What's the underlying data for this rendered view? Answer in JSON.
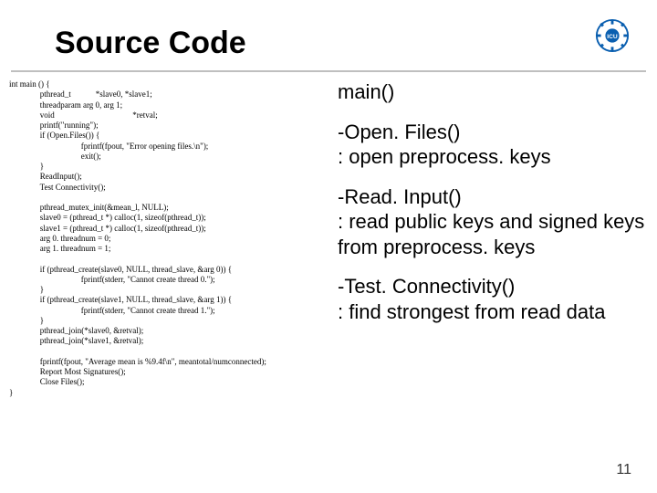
{
  "title": "Source Code",
  "page_number": "11",
  "code": "int main () {\n               pthread_t            *slave0, *slave1;\n               threadparam arg 0, arg 1;\n               void                                      *retval;\n               printf(\"running\");\n               if (Open.Files()) {\n                                   fprintf(fpout, \"Error opening files.\\n\");\n                                   exit();\n               }\n               ReadInput();\n               Test Connectivity();\n\n               pthread_mutex_init(&mean_l, NULL);\n               slave0 = (pthread_t *) calloc(1, sizeof(pthread_t));\n               slave1 = (pthread_t *) calloc(1, sizeof(pthread_t));\n               arg 0. threadnum = 0;\n               arg 1. threadnum = 1;\n\n               if (pthread_create(slave0, NULL, thread_slave, &arg 0)) {\n                                   fprintf(stderr, \"Cannot create thread 0.\");\n               }\n               if (pthread_create(slave1, NULL, thread_slave, &arg 1)) {\n                                   fprintf(stderr, \"Cannot create thread 1.\");\n               }\n               pthread_join(*slave0, &retval);\n               pthread_join(*slave1, &retval);\n\n               fprintf(fpout, \"Average mean is %9.4f\\n\", meantotal/numconnected);\n               Report Most Signatures();\n               Close Files();\n}",
  "explanations": [
    "main()",
    "-Open. Files()\n: open preprocess. keys",
    "-Read. Input()\n: read public keys and signed keys from preprocess. keys",
    "-Test. Connectivity()\n: find strongest from read data"
  ]
}
